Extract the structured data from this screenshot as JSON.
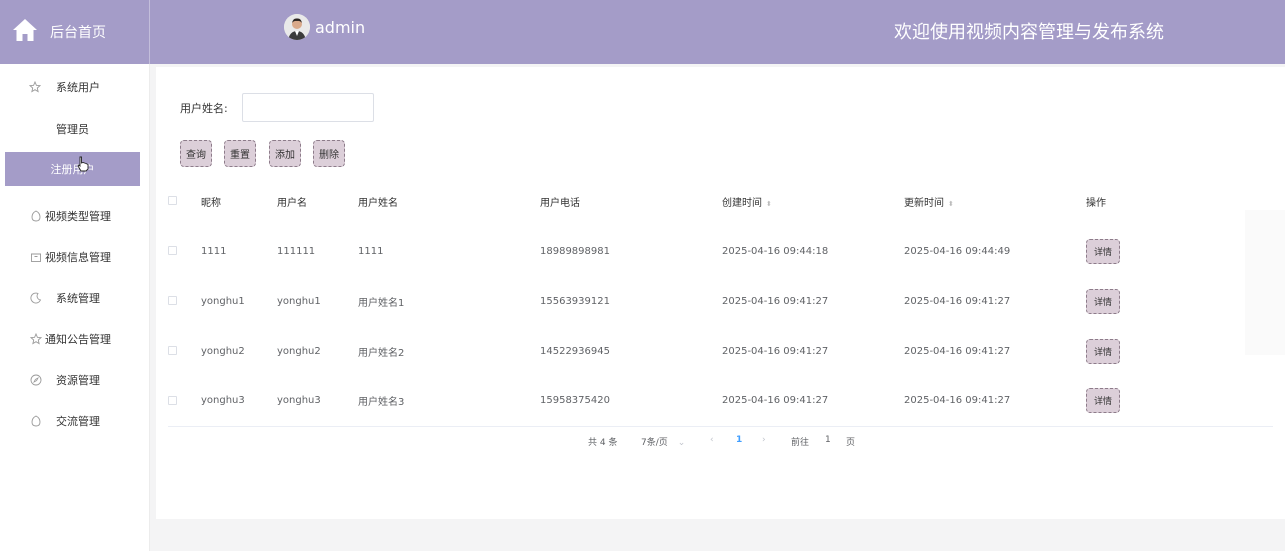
{
  "header": {
    "home_label": "后台首页",
    "user_name": "admin",
    "system_title": "欢迎使用视频内容管理与发布系统"
  },
  "sidebar": {
    "items": [
      {
        "label": "系统用户",
        "icon": "star-icon"
      },
      {
        "label": "管理员"
      },
      {
        "label": "注册用户",
        "active": true
      },
      {
        "label": "视频类型管理",
        "icon": "egg-icon"
      },
      {
        "label": "视频信息管理",
        "icon": "box-icon"
      },
      {
        "label": "系统管理",
        "icon": "moon-icon"
      },
      {
        "label": "通知公告管理",
        "icon": "star-icon"
      },
      {
        "label": "资源管理",
        "icon": "compass-icon"
      },
      {
        "label": "交流管理",
        "icon": "egg-icon"
      }
    ]
  },
  "search": {
    "label": "用户姓名:",
    "value": "",
    "placeholder": ""
  },
  "toolbar": {
    "query": "查询",
    "reset": "重置",
    "add": "添加",
    "delete": "删除"
  },
  "table": {
    "columns": [
      "昵称",
      "用户名",
      "用户姓名",
      "用户电话",
      "创建时间",
      "更新时间",
      "操作"
    ],
    "rows": [
      {
        "nickname": "1111",
        "username": "111111",
        "realname": "1111",
        "phone": "18989898981",
        "created": "2025-04-16 09:44:18",
        "updated": "2025-04-16 09:44:49",
        "action": "详情"
      },
      {
        "nickname": "yonghu1",
        "username": "yonghu1",
        "realname": "用户姓名1",
        "phone": "15563939121",
        "created": "2025-04-16 09:41:27",
        "updated": "2025-04-16 09:41:27",
        "action": "详情"
      },
      {
        "nickname": "yonghu2",
        "username": "yonghu2",
        "realname": "用户姓名2",
        "phone": "14522936945",
        "created": "2025-04-16 09:41:27",
        "updated": "2025-04-16 09:41:27",
        "action": "详情"
      },
      {
        "nickname": "yonghu3",
        "username": "yonghu3",
        "realname": "用户姓名3",
        "phone": "15958375420",
        "created": "2025-04-16 09:41:27",
        "updated": "2025-04-16 09:41:27",
        "action": "详情"
      }
    ]
  },
  "pagination": {
    "total": "共 4 条",
    "page_size": "7条/页",
    "current_page": "1",
    "goto_label": "前往",
    "goto_value": "1",
    "page_suffix": "页"
  },
  "colors": {
    "header_bg": "#a49cc8",
    "active_menu_bg": "#a49cc8",
    "button_bg": "#dccfd9",
    "pager_active": "#409eff"
  }
}
